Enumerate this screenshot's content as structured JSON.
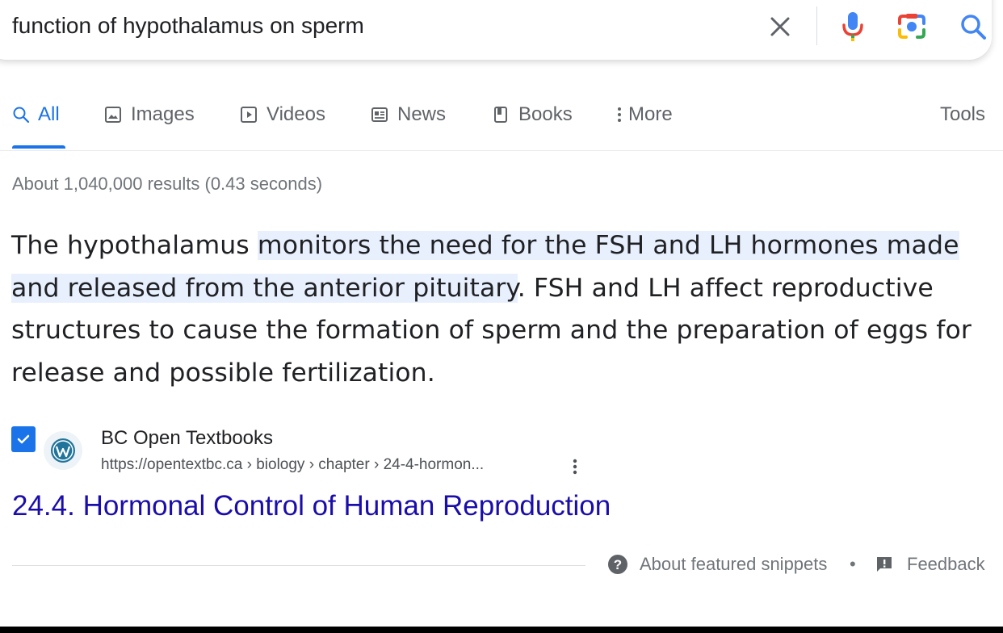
{
  "search": {
    "query": "function of hypothalamus on sperm"
  },
  "tabs": [
    {
      "label": "All",
      "icon": "search-icon"
    },
    {
      "label": "Images",
      "icon": "image-icon"
    },
    {
      "label": "Videos",
      "icon": "play-icon"
    },
    {
      "label": "News",
      "icon": "newspaper-icon"
    },
    {
      "label": "Books",
      "icon": "book-icon"
    },
    {
      "label": "More",
      "icon": "more-vert-icon"
    }
  ],
  "tools_label": "Tools",
  "result_stats": "About 1,040,000 results (0.43 seconds)",
  "snippet": {
    "part1": "The hypothalamus ",
    "highlight": "monitors the need for the FSH and LH hormones made and released from the anterior pituitary",
    "part2": ". FSH and LH affect reproductive structures to cause the formation of sperm and the preparation of eggs for release and possible fertilization."
  },
  "source": {
    "name": "BC Open Textbooks",
    "url": "https://opentextbc.ca › biology › chapter › 24-4-hormon...",
    "title": "24.4. Hormonal Control of Human Reproduction"
  },
  "footer": {
    "about_snippets": "About featured snippets",
    "separator": "•",
    "feedback": "Feedback"
  },
  "colors": {
    "accent": "#1a73e8",
    "link": "#1a0dab",
    "highlight": "#e8f0fe"
  }
}
